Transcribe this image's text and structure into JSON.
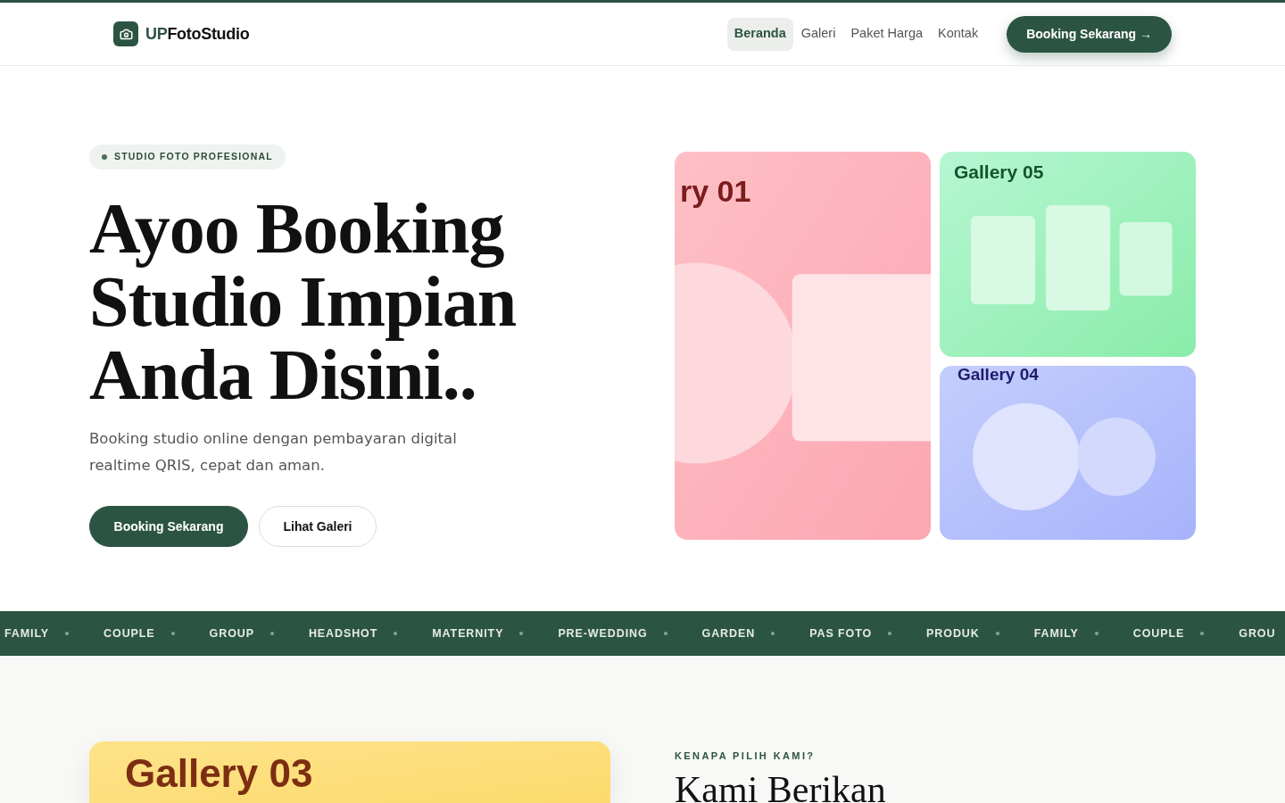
{
  "navbar": {
    "brand": {
      "accent": "UP",
      "rest": "FotoStudio"
    },
    "links": [
      {
        "label": "Beranda",
        "selected": true
      },
      {
        "label": "Galeri",
        "selected": false
      },
      {
        "label": "Paket Harga",
        "selected": false
      },
      {
        "label": "Kontak",
        "selected": false
      }
    ],
    "cta": "Booking Sekarang →"
  },
  "hero": {
    "badge": "STUDIO FOTO PROFESIONAL",
    "title_lines": [
      "Ayoo Booking",
      "Studio Impian",
      "Anda Disini.."
    ],
    "subtitle": "Booking studio online dengan pembayaran digital realtime QRIS, cepat dan aman.",
    "buttons": [
      {
        "label": "Booking Sekarang",
        "kind": "primary"
      },
      {
        "label": "Lihat Galeri",
        "kind": "outline"
      }
    ]
  },
  "gallery": [
    {
      "title": "ry 01",
      "kind": "shapes"
    },
    {
      "title": "Gallery 05",
      "kind": "frames"
    },
    {
      "title": "Gallery 04",
      "kind": "bubbles"
    }
  ],
  "marquee": [
    "FAMILY",
    "COUPLE",
    "GROUP",
    "HEADSHOT",
    "MATERNITY",
    "PRE-WEDDING",
    "GARDEN",
    "PAS FOTO",
    "PRODUK",
    "FAMILY",
    "COUPLE",
    "GROU"
  ],
  "why_section": {
    "feature_card": {
      "title": "Gallery 03"
    },
    "eyebrow": "KENAPA PILIH KAMI?",
    "heading": "Kami Berikan"
  }
}
